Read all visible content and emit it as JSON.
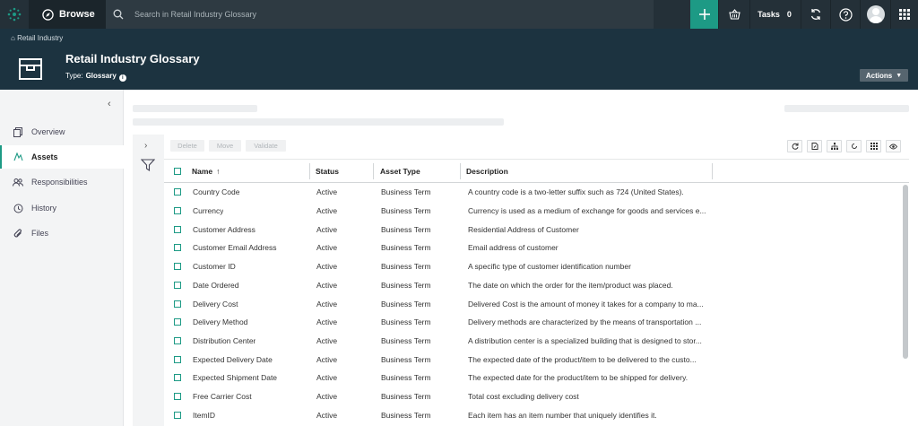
{
  "topbar": {
    "browse_label": "Browse",
    "search_placeholder": "Search in Retail Industry Glossary",
    "tasks_label": "Tasks",
    "tasks_count": "0",
    "accent_color": "#1d9a85"
  },
  "header": {
    "breadcrumb": "Retail Industry",
    "title": "Retail Industry Glossary",
    "type_label": "Type:",
    "type_value": "Glossary",
    "info_glyph": "i",
    "actions_label": "Actions"
  },
  "sidebar": {
    "items": [
      {
        "label": "Overview",
        "icon": "overview-icon"
      },
      {
        "label": "Assets",
        "icon": "assets-icon",
        "active": true
      },
      {
        "label": "Responsibilities",
        "icon": "responsibilities-icon"
      },
      {
        "label": "History",
        "icon": "history-icon"
      },
      {
        "label": "Files",
        "icon": "files-icon"
      }
    ]
  },
  "toolbar": {
    "delete_label": "Delete",
    "move_label": "Move",
    "validate_label": "Validate"
  },
  "table": {
    "columns": [
      "Name",
      "Status",
      "Asset Type",
      "Description"
    ],
    "sort_indicator": "↑",
    "rows": [
      {
        "name": "Country Code",
        "status": "Active",
        "type": "Business Term",
        "description": "A country code is a two-letter suffix such as 724 (United States)."
      },
      {
        "name": "Currency",
        "status": "Active",
        "type": "Business Term",
        "description": "Currency is used as a medium of exchange for goods and services e..."
      },
      {
        "name": "Customer Address",
        "status": "Active",
        "type": "Business Term",
        "description": "Residential Address of Customer"
      },
      {
        "name": "Customer Email Address",
        "status": "Active",
        "type": "Business Term",
        "description": "Email address of customer"
      },
      {
        "name": "Customer ID",
        "status": "Active",
        "type": "Business Term",
        "description": "A specific type of customer identification number"
      },
      {
        "name": "Date Ordered",
        "status": "Active",
        "type": "Business Term",
        "description": "The date on which the order for the item/product was placed."
      },
      {
        "name": "Delivery Cost",
        "status": "Active",
        "type": "Business Term",
        "description": "Delivered Cost is the amount of money it takes for a company to ma..."
      },
      {
        "name": "Delivery Method",
        "status": "Active",
        "type": "Business Term",
        "description": "Delivery methods are characterized by the means of transportation ..."
      },
      {
        "name": "Distribution Center",
        "status": "Active",
        "type": "Business Term",
        "description": "A distribution center is a specialized building that is designed to stor..."
      },
      {
        "name": "Expected Delivery Date",
        "status": "Active",
        "type": "Business Term",
        "description": "The expected date of the product/item to be delivered to the custo..."
      },
      {
        "name": "Expected Shipment Date",
        "status": "Active",
        "type": "Business Term",
        "description": "The expected date for the product/item to be shipped for delivery."
      },
      {
        "name": "Free Carrier Cost",
        "status": "Active",
        "type": "Business Term",
        "description": "Total cost excluding delivery cost"
      },
      {
        "name": "ItemID",
        "status": "Active",
        "type": "Business Term",
        "description": "Each item has an item number that uniquely identifies it."
      }
    ]
  }
}
